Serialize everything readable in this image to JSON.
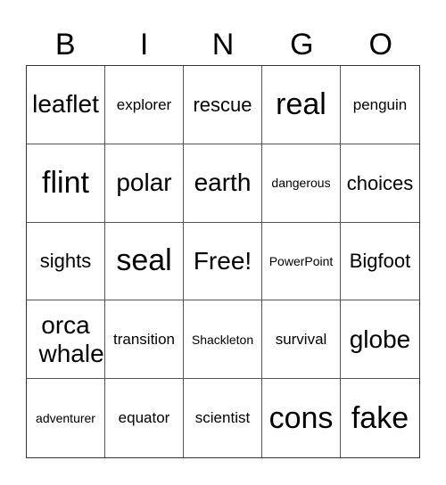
{
  "header": [
    "B",
    "I",
    "N",
    "G",
    "O"
  ],
  "cells": [
    {
      "text": "leaflet",
      "size": "xl"
    },
    {
      "text": "explorer",
      "size": "m"
    },
    {
      "text": "rescue",
      "size": "l"
    },
    {
      "text": "real",
      "size": "xxl"
    },
    {
      "text": "penguin",
      "size": "m"
    },
    {
      "text": "flint",
      "size": "xxl"
    },
    {
      "text": "polar",
      "size": "xl"
    },
    {
      "text": "earth",
      "size": "xl"
    },
    {
      "text": "dangerous",
      "size": "s"
    },
    {
      "text": "choices",
      "size": "l"
    },
    {
      "text": "sights",
      "size": "l"
    },
    {
      "text": "seal",
      "size": "xxl"
    },
    {
      "text": "Free!",
      "size": "xl"
    },
    {
      "text": "PowerPoint",
      "size": "s"
    },
    {
      "text": "Bigfoot",
      "size": "l"
    },
    {
      "text": "orca whale",
      "size": "xl"
    },
    {
      "text": "transition",
      "size": "m"
    },
    {
      "text": "Shackleton",
      "size": "s"
    },
    {
      "text": "survival",
      "size": "m"
    },
    {
      "text": "globe",
      "size": "xl"
    },
    {
      "text": "adventurer",
      "size": "s"
    },
    {
      "text": "equator",
      "size": "m"
    },
    {
      "text": "scientist",
      "size": "m"
    },
    {
      "text": "cons",
      "size": "xxl"
    },
    {
      "text": "fake",
      "size": "xxl"
    }
  ]
}
